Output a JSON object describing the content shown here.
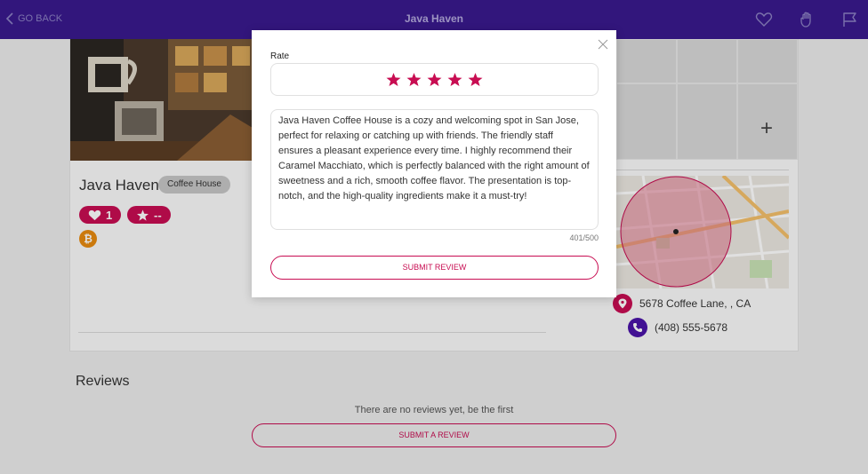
{
  "header": {
    "back_label": "GO BACK",
    "title": "Java Haven",
    "icons": [
      "heart-icon",
      "hand-icon",
      "flag-icon"
    ]
  },
  "business": {
    "name": "Java Haven",
    "category": "Coffee House",
    "likes_count": "1",
    "rating_value": "--",
    "payment_icon": "bitcoin-icon",
    "address": "5678 Coffee Lane, , CA",
    "phone": "(408) 555-5678"
  },
  "reviews": {
    "title": "Reviews",
    "empty_text": "There are no reviews yet, be the first",
    "submit_label": "SUBMIT A REVIEW"
  },
  "modal": {
    "rate_label": "Rate",
    "stars_selected": 5,
    "stars_total": 5,
    "review_text": "Java Haven Coffee House is a cozy and welcoming spot in San Jose, perfect for relaxing or catching up with friends. The friendly staff ensures a pleasant experience every time. I highly recommend their Caramel Macchiato, which is perfectly balanced with the right amount of sweetness and a rich, smooth coffee flavor. The presentation is top-notch, and the high-quality ingredients make it a must-try!",
    "char_count": "401/500",
    "submit_label": "SUBMIT REVIEW"
  },
  "colors": {
    "header_bg": "#3a1a8e",
    "accent": "#c80d52",
    "phone_badge": "#4a13a8",
    "bitcoin": "#e88a0f"
  }
}
